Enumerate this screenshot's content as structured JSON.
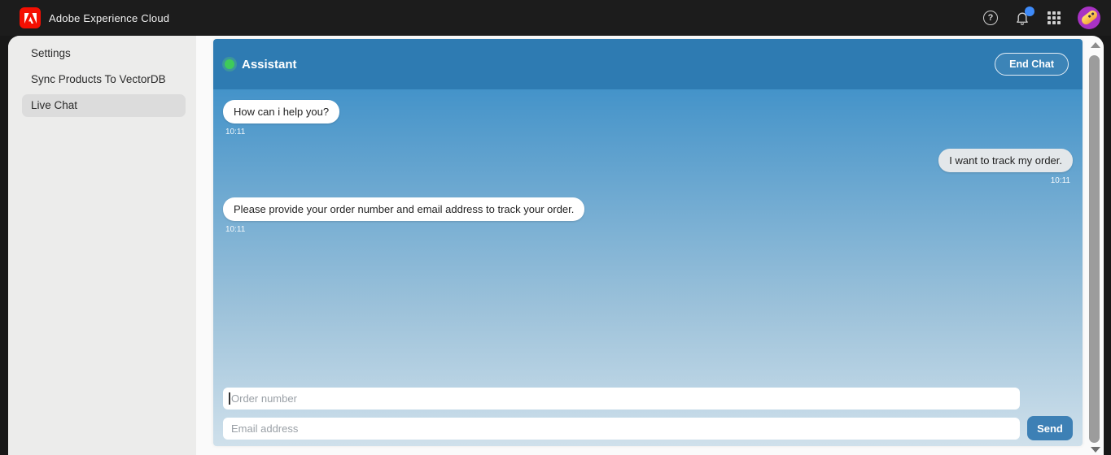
{
  "topbar": {
    "app_title": "Adobe Experience Cloud",
    "icons": [
      "adobe-logo",
      "help-icon",
      "bell-icon",
      "app-switcher-icon",
      "avatar"
    ],
    "notification_badge": true
  },
  "sidebar": {
    "items": [
      {
        "label": "Settings",
        "selected": false
      },
      {
        "label": "Sync Products To VectorDB",
        "selected": false
      },
      {
        "label": "Live Chat",
        "selected": true
      }
    ]
  },
  "chat": {
    "header": {
      "title": "Assistant",
      "status": "online",
      "end_chat_label": "End Chat"
    },
    "messages": [
      {
        "sender": "assistant",
        "text": "How can i help you?",
        "time": "10:11"
      },
      {
        "sender": "user",
        "text": "I want to track my order.",
        "time": "10:11"
      },
      {
        "sender": "assistant",
        "text": "Please provide your order number and email address to track your order.",
        "time": "10:11"
      }
    ],
    "inputs": {
      "order_placeholder": "Order number",
      "email_placeholder": "Email address",
      "send_label": "Send"
    }
  },
  "colors": {
    "adobe_red": "#f40f02",
    "topbar_bg": "#1c1c1c",
    "chat_header_blue": "#2e7bb2",
    "gradient_top": "#4493c9",
    "gradient_bottom": "#cfe0eb",
    "send_blue": "#3d80b5",
    "online_green": "#3ecb5a",
    "notification_blue": "#3e8bfa",
    "sidebar_bg": "#ececeb",
    "selected_item_bg": "#dcdcdc"
  }
}
